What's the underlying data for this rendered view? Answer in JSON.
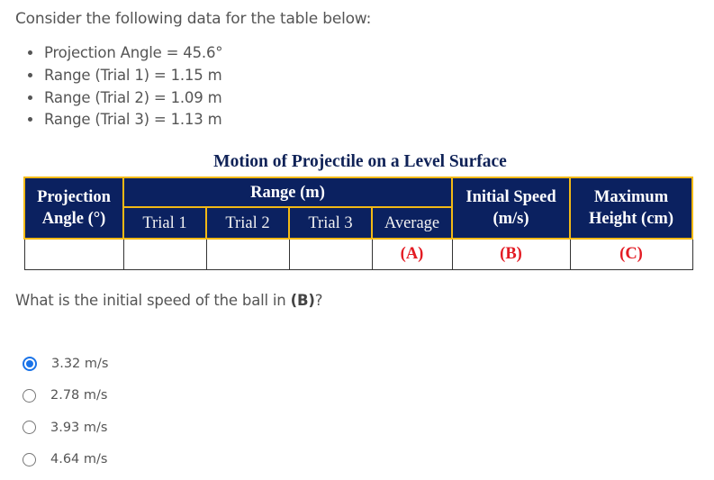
{
  "intro": "Consider the following data for the table below:",
  "data_items": [
    "Projection Angle = 45.6°",
    "Range (Trial 1) = 1.15 m",
    "Range (Trial 2) = 1.09 m",
    "Range (Trial 3) = 1.13 m"
  ],
  "table": {
    "title": "Motion of Projectile on a Level Surface",
    "headers": {
      "angle_line1": "Projection",
      "angle_line2": "Angle (°)",
      "range": "Range (m)",
      "trial1": "Trial 1",
      "trial2": "Trial 2",
      "trial3": "Trial 3",
      "average": "Average",
      "speed_line1": "Initial Speed",
      "speed_line2": "(m/s)",
      "height_line1": "Maximum",
      "height_line2": "Height (cm)"
    },
    "row": [
      "",
      "",
      "",
      "",
      "(A)",
      "(B)",
      "(C)"
    ],
    "colors": {
      "header_bg": "#0b2160",
      "header_border": "#f2b915",
      "marker_text": "#e31b23"
    }
  },
  "question": {
    "prefix": "What is the initial speed of the ball in ",
    "bold": "(B)",
    "suffix": "?"
  },
  "options": [
    {
      "label": "3.32 m/s",
      "selected": true
    },
    {
      "label": "2.78 m/s",
      "selected": false
    },
    {
      "label": "3.93 m/s",
      "selected": false
    },
    {
      "label": "4.64 m/s",
      "selected": false
    }
  ],
  "accent_color": "#1a73e8"
}
